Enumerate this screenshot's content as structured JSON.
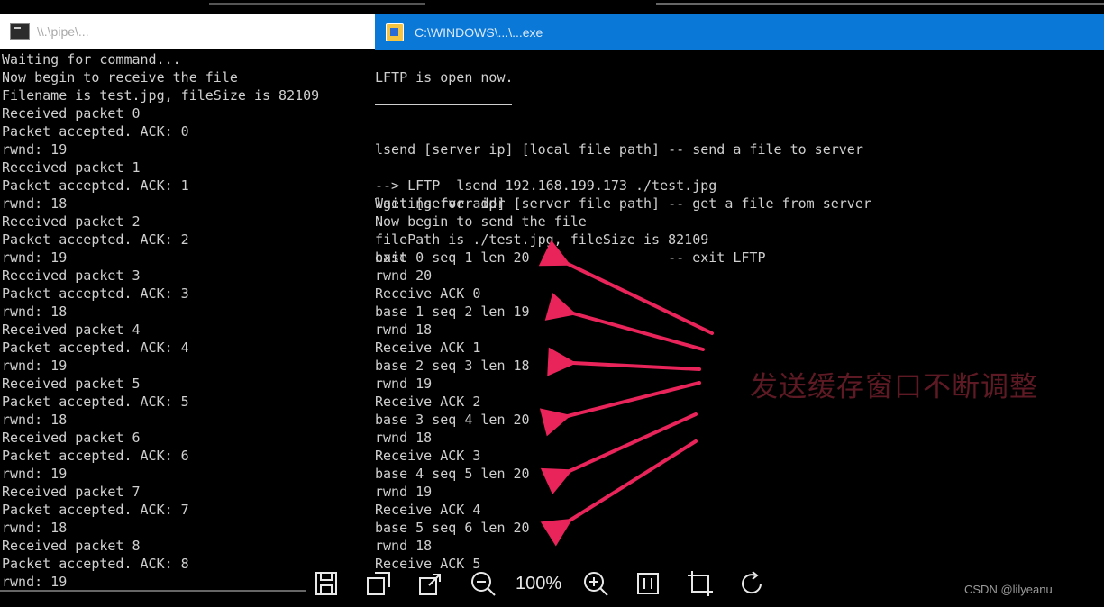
{
  "left_window": {
    "title": "\\\\.\\pipe\\...",
    "lines": [
      "Waiting for command...",
      "Now begin to receive the file",
      "Filename is test.jpg, fileSize is 82109",
      "Received packet 0",
      "Packet accepted. ACK: 0",
      "rwnd: 19",
      "Received packet 1",
      "Packet accepted. ACK: 1",
      "rwnd: 18",
      "Received packet 2",
      "Packet accepted. ACK: 2",
      "rwnd: 19",
      "Received packet 3",
      "Packet accepted. ACK: 3",
      "rwnd: 18",
      "Received packet 4",
      "Packet accepted. ACK: 4",
      "rwnd: 19",
      "Received packet 5",
      "Packet accepted. ACK: 5",
      "rwnd: 18",
      "Received packet 6",
      "Packet accepted. ACK: 6",
      "rwnd: 19",
      "Received packet 7",
      "Packet accepted. ACK: 7",
      "rwnd: 18",
      "Received packet 8",
      "Packet accepted. ACK: 8",
      "rwnd: 19"
    ]
  },
  "right_window": {
    "title": "C:\\WINDOWS\\...\\...exe",
    "header": "LFTP is open now.",
    "commands": [
      "lsend [server ip] [local file path] -- send a file to server",
      "lget [server ip] [server file path] -- get a file from server",
      "exit                                -- exit LFTP"
    ],
    "lines": [
      "--> LFTP  lsend 192.168.199.173 ./test.jpg",
      "Waiting for addr",
      "Now begin to send the file",
      "filePath is ./test.jpg, fileSize is 82109",
      "base 0 seq 1 len 20",
      "rwnd 20",
      "Receive ACK 0",
      "base 1 seq 2 len 19",
      "rwnd 18",
      "Receive ACK 1",
      "base 2 seq 3 len 18",
      "rwnd 19",
      "Receive ACK 2",
      "base 3 seq 4 len 20",
      "rwnd 18",
      "Receive ACK 3",
      "base 4 seq 5 len 20",
      "rwnd 19",
      "Receive ACK 4",
      "base 5 seq 6 len 20",
      "rwnd 18",
      "Receive ACK 5"
    ]
  },
  "annotation": "发送缓存窗口不断调整",
  "toolbar": {
    "zoom": "100%",
    "icons": [
      "save-icon",
      "edit-image-icon",
      "share-icon",
      "zoom-out-icon",
      "zoom-in-icon",
      "fit-page-icon",
      "crop-icon",
      "rotate-icon"
    ]
  },
  "watermark": "CSDN @lilyeanu",
  "colors": {
    "console_bg": "#000000",
    "console_text": "#cfcfcf",
    "titlebar_active": "#0a78d7",
    "arrow": "#e8245a",
    "annotation": "#5e1a24"
  }
}
